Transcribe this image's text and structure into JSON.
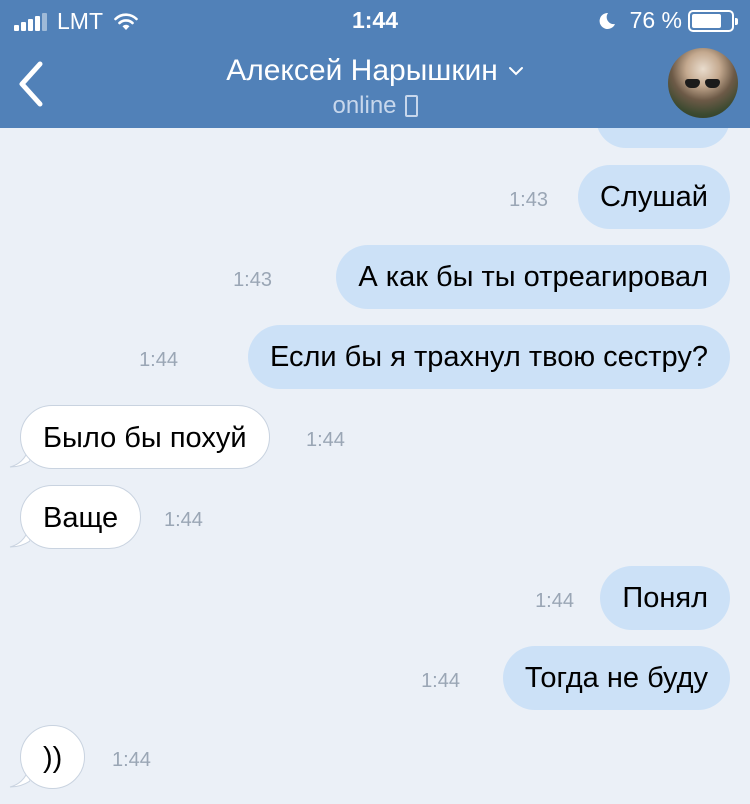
{
  "status_bar": {
    "carrier": "LMT",
    "time": "1:44",
    "battery_percent": "76 %",
    "battery_level": 0.76
  },
  "chat_header": {
    "contact_name": "Алексей Нарышкин",
    "status": "online"
  },
  "colors": {
    "header_bg": "#5181b8",
    "chat_bg": "#ebf0f7",
    "outgoing_bubble": "#cce1f7",
    "incoming_bubble": "#ffffff",
    "timestamp": "#9aa6b5"
  },
  "messages": [
    {
      "direction": "out",
      "text": "Слушай",
      "time": "1:43"
    },
    {
      "direction": "out",
      "text": "А как бы ты отреагировал",
      "time": "1:43"
    },
    {
      "direction": "out",
      "text": "Если бы я трахнул твою сестру?",
      "time": "1:44"
    },
    {
      "direction": "in",
      "text": "Было бы похуй",
      "time": "1:44"
    },
    {
      "direction": "in",
      "text": "Ваще",
      "time": "1:44"
    },
    {
      "direction": "out",
      "text": "Понял",
      "time": "1:44"
    },
    {
      "direction": "out",
      "text": "Тогда не буду",
      "time": "1:44"
    },
    {
      "direction": "in",
      "text": "))",
      "time": "1:44"
    }
  ]
}
